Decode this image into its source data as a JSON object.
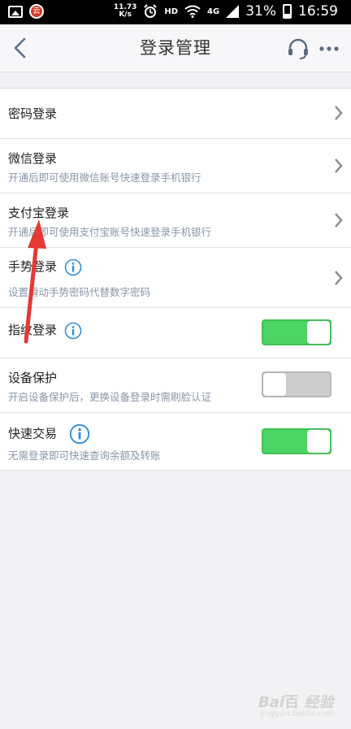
{
  "status_bar": {
    "speed_value": "11.73",
    "speed_unit": "K/s",
    "hd_label": "HD",
    "network_label": "4G",
    "battery_percent": "31%",
    "time": "16:59"
  },
  "nav": {
    "title": "登录管理",
    "back_icon": "chevron-left-icon",
    "service_icon": "headset-icon",
    "more_icon": "more-icon"
  },
  "items": [
    {
      "title": "密码登录",
      "subtitle": "",
      "control": "chevron"
    },
    {
      "title": "微信登录",
      "subtitle": "开通后即可使用微信账号快速登录手机银行",
      "control": "chevron"
    },
    {
      "title": "支付宝登录",
      "subtitle": "开通后即可使用支付宝账号快速登录手机银行",
      "control": "chevron"
    },
    {
      "title": "手势登录",
      "subtitle": "设置滑动手势密码代替数字密码",
      "control": "chevron",
      "info": true
    },
    {
      "title": "指纹登录",
      "subtitle": "",
      "control": "toggle",
      "toggle_on": true,
      "info": true
    },
    {
      "title": "设备保护",
      "subtitle": "开启设备保护后，更换设备登录时需刷脸认证",
      "control": "toggle",
      "toggle_on": false
    },
    {
      "title": "快速交易",
      "subtitle": "无需登录即可快速查询余额及转账",
      "control": "toggle",
      "toggle_on": true,
      "info": true
    }
  ],
  "colors": {
    "toggle_on": "#4cd464",
    "toggle_off": "#cdcdcd",
    "info_icon": "#2f8fd8",
    "subtitle": "#8a96a8",
    "annotation_arrow": "#e53935"
  },
  "watermark": {
    "text": "Bai百 经验",
    "sub": "jingyan.baidu.com"
  }
}
